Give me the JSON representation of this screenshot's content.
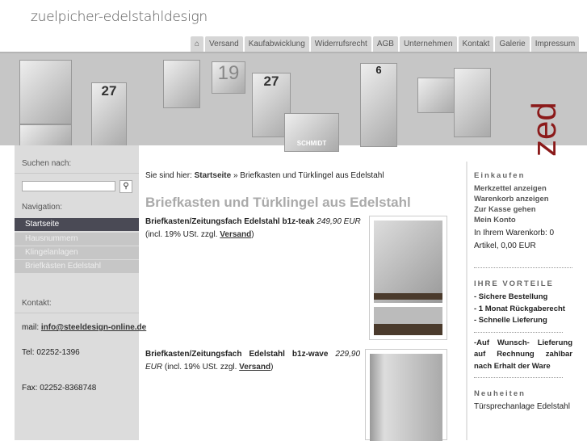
{
  "header": {
    "logo": "zuelpicher-edelstahldesign",
    "tabs": [
      "Versand",
      "Kaufabwicklung",
      "Widerrufsrecht",
      "AGB",
      "Unternehmen",
      "Kontakt",
      "Galerie",
      "Impressum"
    ]
  },
  "banner": {
    "numbers": [
      "27",
      "19",
      "27",
      "6"
    ],
    "plate": "SCHMIDT",
    "brand": "zed"
  },
  "sidebar": {
    "search_label": "Suchen nach:",
    "search_value": "",
    "nav_label": "Navigation:",
    "nav": [
      "Startseite",
      "Hausnummern",
      "Klingelanlagen",
      "Briefkästen Edelstahl"
    ],
    "contact_label": "Kontakt:",
    "mail_prefix": "mail: ",
    "mail": "info@steeldesign-online.de",
    "tel": "Tel: 02252-1396",
    "fax": "Fax: 02252-8368748"
  },
  "main": {
    "breadcrumb_prefix": "Sie sind hier: ",
    "breadcrumb_home": "Startseite",
    "breadcrumb_sep": " » ",
    "breadcrumb_current": "Briefkasten und Türklingel aus Edelstahl",
    "title": "Briefkasten und Türklingel aus Edelstahl",
    "products": [
      {
        "name": "Briefkasten/Zeitungsfach Edelstahl b1z-teak",
        "price": "249,90 EUR",
        "tax": "(incl. 19% USt. zzgl. ",
        "shipping": "Versand",
        "close": ")"
      },
      {
        "name": "Briefkasten/Zeitungsfach Edelstahl b1z-wave",
        "price": "229,90 EUR",
        "tax": "(incl. 19% USt. zzgl. ",
        "shipping": "Versand",
        "close": ")"
      }
    ]
  },
  "right": {
    "shop_title": "Einkaufen",
    "shop_links": [
      "Merkzettel anzeigen",
      "Warenkorb anzeigen",
      "Zur Kasse gehen",
      "Mein Konto"
    ],
    "cart": "In Ihrem Warenkorb: 0 Artikel, 0,00 EUR",
    "adv_title": "IHRE VORTEILE",
    "advantages": [
      "- Sichere Bestellung",
      "- 1 Monat Rückgaberecht",
      "- Schnelle Lieferung"
    ],
    "extra": "-Auf Wunsch- Lieferung auf Rechnung zahlbar nach Erhalt der Ware",
    "news_title": "Neuheiten",
    "news": [
      "Türsprechanlage Edelstahl"
    ]
  }
}
